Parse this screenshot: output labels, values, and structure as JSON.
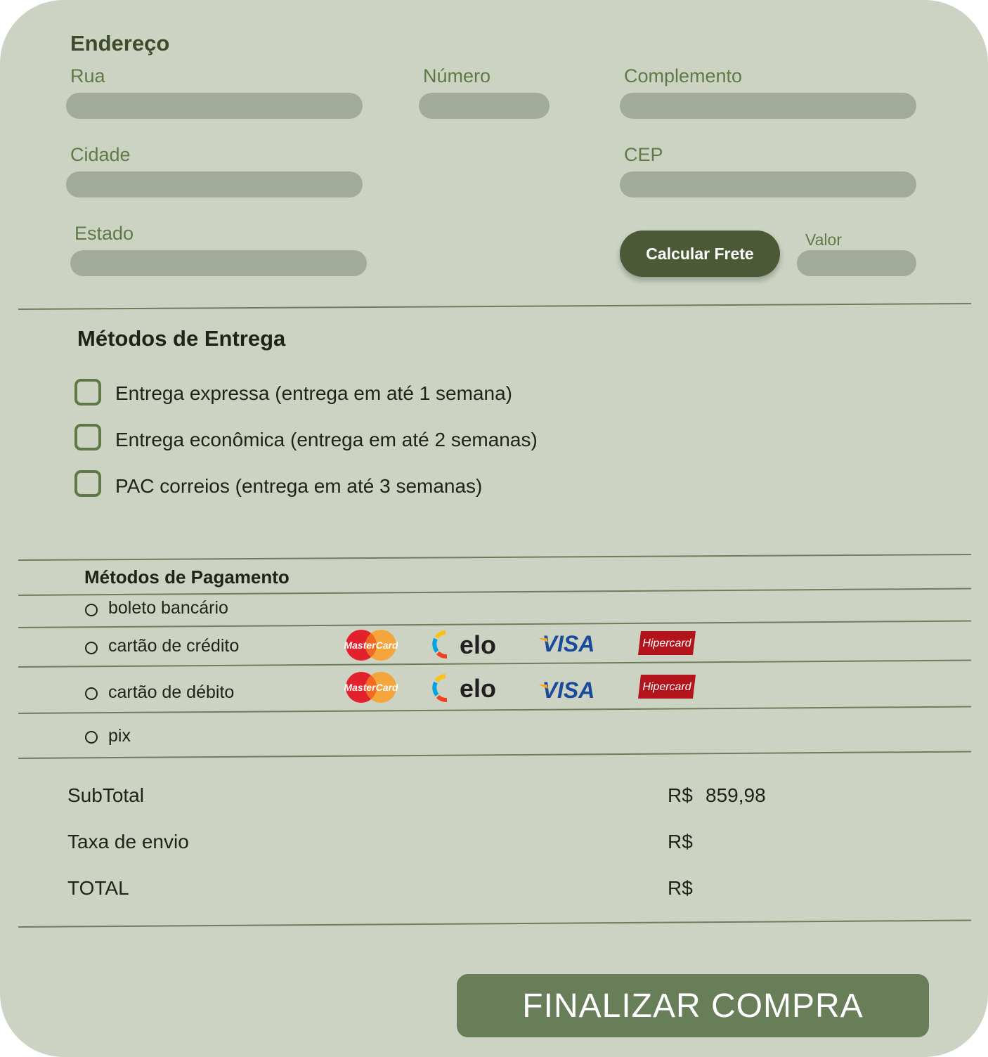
{
  "address": {
    "title": "Endereço",
    "rua_label": "Rua",
    "numero_label": "Número",
    "complemento_label": "Complemento",
    "cidade_label": "Cidade",
    "cep_label": "CEP",
    "estado_label": "Estado",
    "calc_button": "Calcular Frete",
    "valor_label": "Valor"
  },
  "delivery": {
    "title": "Métodos de Entrega",
    "options": [
      "Entrega expressa (entrega em até 1 semana)",
      "Entrega econômica (entrega em até 2 semanas)",
      "PAC correios (entrega em até 3 semanas)"
    ]
  },
  "payment": {
    "title": "Métodos de Pagamento",
    "options": [
      "boleto bancário",
      "cartão de crédito",
      "cartão de débito",
      "pix"
    ],
    "card_brands": [
      "MasterCard",
      "elo",
      "VISA",
      "Hipercard"
    ]
  },
  "summary": {
    "subtotal_label": "SubTotal",
    "subtotal_currency": "R$",
    "subtotal_value": "859,98",
    "shipping_label": "Taxa de envio",
    "shipping_currency": "R$",
    "total_label": "TOTAL",
    "total_currency": "R$"
  },
  "finalize_button": "FINALIZAR COMPRA",
  "colors": {
    "background": "#ccd3c2",
    "field": "#a2aa99",
    "accent_dark": "#4b5937",
    "accent": "#677e59",
    "label": "#607a47"
  }
}
